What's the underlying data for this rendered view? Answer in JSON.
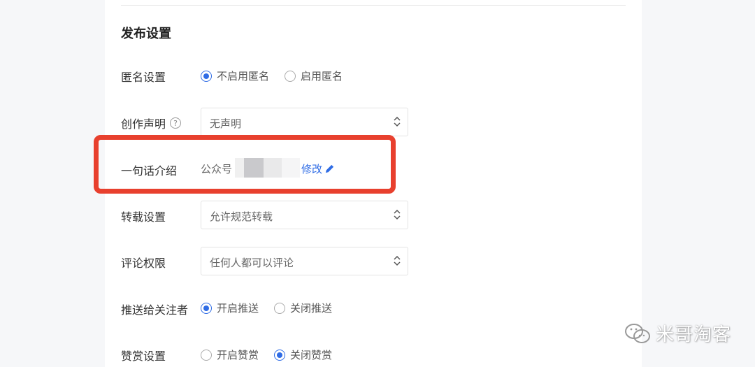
{
  "section_title": "发布设置",
  "rows": {
    "anonymous": {
      "label": "匿名设置",
      "options": [
        {
          "label": "不启用匿名",
          "checked": true
        },
        {
          "label": "启用匿名",
          "checked": false
        }
      ]
    },
    "declaration": {
      "label": "创作声明",
      "help_icon": "question-circle-icon",
      "value": "无声明"
    },
    "intro": {
      "label": "一句话介绍",
      "prefix": "公众号",
      "edit_label": "修改",
      "edit_icon": "pencil-icon"
    },
    "repost": {
      "label": "转载设置",
      "value": "允许规范转载"
    },
    "comment": {
      "label": "评论权限",
      "value": "任何人都可以评论"
    },
    "push": {
      "label": "推送给关注者",
      "options": [
        {
          "label": "开启推送",
          "checked": true
        },
        {
          "label": "关闭推送",
          "checked": false
        }
      ]
    },
    "reward": {
      "label": "赞赏设置",
      "options": [
        {
          "label": "开启赞赏",
          "checked": false
        },
        {
          "label": "关闭赞赏",
          "checked": true
        }
      ]
    }
  },
  "watermark": {
    "text": "米哥淘客",
    "icon": "wechat-icon"
  },
  "colors": {
    "accent": "#2f6ce5",
    "highlight": "#e8402e"
  }
}
